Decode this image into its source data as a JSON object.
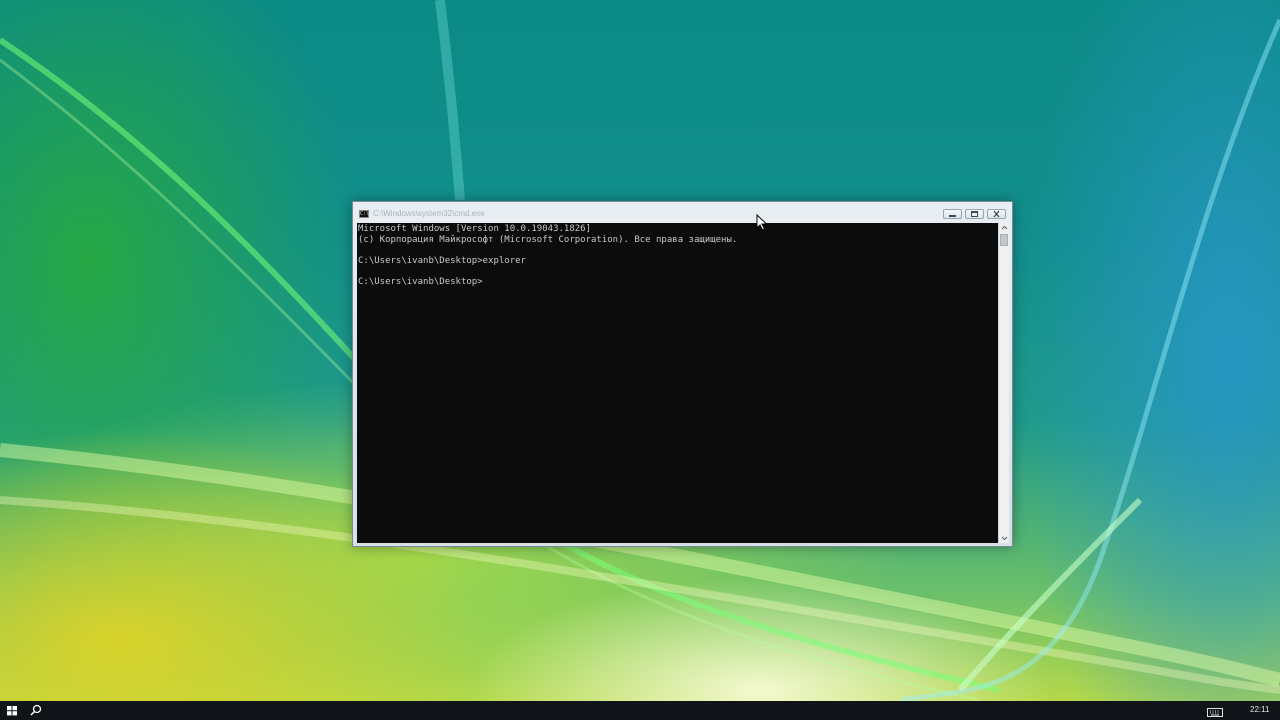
{
  "window": {
    "title": "C:\\Windows\\system32\\cmd.exe",
    "icon_text": "C:\\"
  },
  "console": {
    "lines": [
      "Microsoft Windows [Version 10.0.19043.1826]",
      "(c) Корпорация Майкрософт (Microsoft Corporation). Все права защищены.",
      "",
      "C:\\Users\\ivanb\\Desktop>explorer",
      "",
      "C:\\Users\\ivanb\\Desktop>"
    ]
  },
  "taskbar": {
    "clock": "22:11"
  },
  "icons": {
    "start": "windows-logo-icon",
    "search": "search-icon",
    "keyboard": "keyboard-icon",
    "minimize": "minimize-icon",
    "maximize": "maximize-icon",
    "close": "close-icon"
  },
  "colors": {
    "console_bg": "#0c0c0c",
    "console_text": "#c8c8c8",
    "taskbar_bg": "#101418"
  }
}
